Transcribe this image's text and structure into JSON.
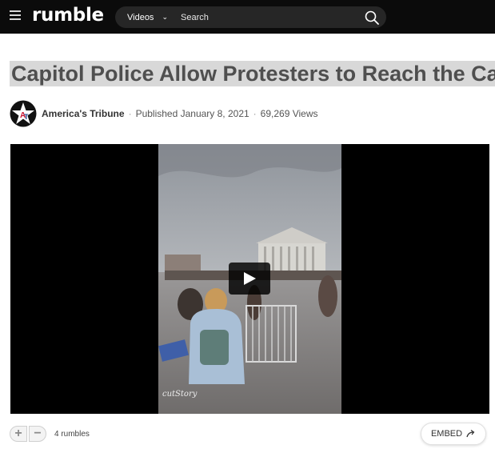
{
  "header": {
    "logo": "rumble",
    "search": {
      "category": "Videos",
      "placeholder": "Search"
    }
  },
  "video": {
    "title": "Capitol Police Allow Protesters to Reach the Capitol",
    "channel": "America's Tribune",
    "published": "Published January 8, 2021",
    "views": "69,269 Views",
    "watermark": "cutStory"
  },
  "actions": {
    "upvote": "+",
    "downvote": "−",
    "rumbles": "4 rumbles",
    "embed_label": "EMBED"
  },
  "colors": {
    "topbar": "#0b0b0b",
    "title_highlight": "#d8d8d8",
    "player_bg": "#000000"
  }
}
